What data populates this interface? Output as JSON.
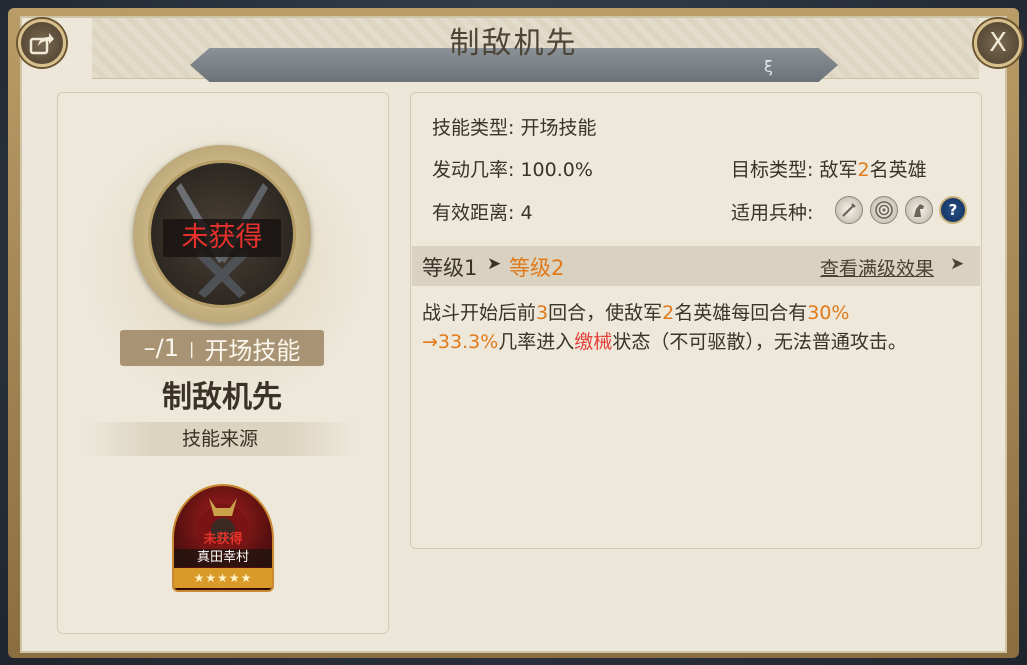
{
  "window": {
    "title": "制敌机先",
    "ribbon_glyph": "ξ",
    "share_icon": "share-icon",
    "close_label": "X"
  },
  "left": {
    "status_overlay": "未获得",
    "level_text": "–/1",
    "level_sep": "|",
    "skill_type_tag": "开场技能",
    "skill_name": "制敌机先",
    "source_label": "技能来源",
    "hero": {
      "lock_text": "未获得",
      "name": "真田幸村",
      "stars": "★★★★★",
      "star_count": 5
    }
  },
  "stats": {
    "type_label": "技能类型:",
    "type_value": "开场技能",
    "rate_label": "发动几率:",
    "rate_value": "100.0%",
    "range_label": "有效距离:",
    "range_value": "4",
    "target_label": "目标类型:",
    "target_pre": "敌军",
    "target_num": "2",
    "target_post": "名英雄",
    "units_label": "适用兵种:",
    "units": [
      "sword-icon",
      "archery-target-icon",
      "horse-icon",
      "question-icon"
    ]
  },
  "levels": {
    "current": "等级1",
    "arrow": "➤",
    "next": "等级2",
    "view_max": "查看满级效果",
    "view_arrow": "➤"
  },
  "description": {
    "p1": "战斗开始后前",
    "n1": "3",
    "p2": "回合，使敌军",
    "n2": "2",
    "p3": "名英雄每回合有",
    "n3": "30%",
    "n4": "→33.3%",
    "p4": "几率进入",
    "status": "缴械",
    "p5": "状态（不可驱散），无法普通攻击。"
  },
  "colors": {
    "accent": "#e07a1a",
    "status_red": "#e8413a",
    "text": "#3a3328",
    "panel": "#ece7d8"
  }
}
